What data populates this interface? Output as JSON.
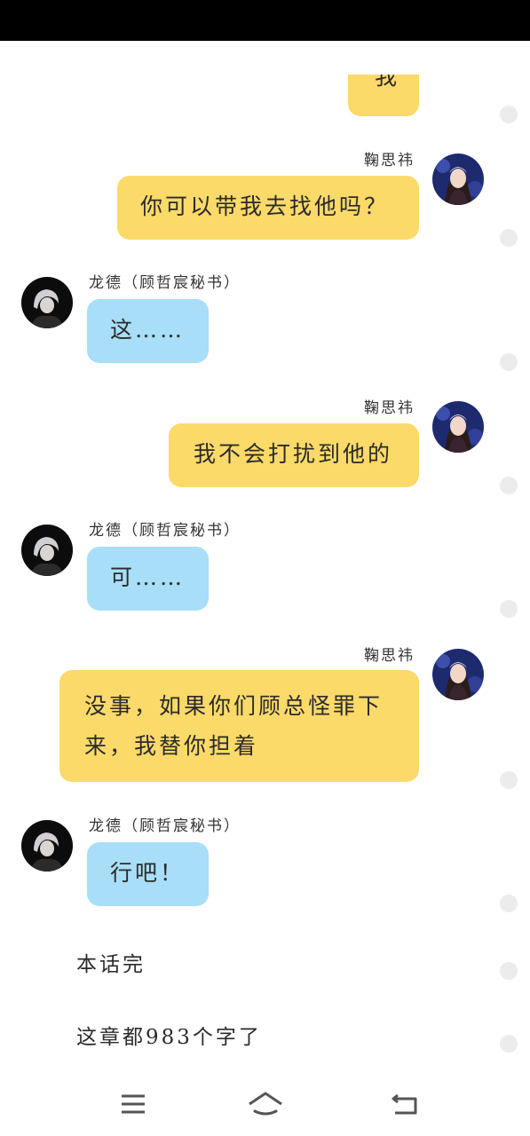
{
  "colors": {
    "my_bubble": "#fbda6a",
    "their_bubble": "#a8def8",
    "status_bar": "#000000"
  },
  "chat": {
    "partial_top": {
      "text": "我"
    },
    "messages": [
      {
        "sender": "鞠思祎",
        "side": "right",
        "text": "你可以带我去找他吗？"
      },
      {
        "sender": "龙德（顾哲宸秘书）",
        "side": "left",
        "text": "这……"
      },
      {
        "sender": "鞠思祎",
        "side": "right",
        "text": "我不会打扰到他的"
      },
      {
        "sender": "龙德（顾哲宸秘书）",
        "side": "left",
        "text": "可……"
      },
      {
        "sender": "鞠思祎",
        "side": "right",
        "lines": [
          "没事，如果你们顾总怪罪下",
          "来，我替你担着"
        ]
      },
      {
        "sender": "龙德（顾哲宸秘书）",
        "side": "left",
        "text": "行吧！"
      }
    ]
  },
  "footer_text": {
    "end_note": "本话完",
    "word_count_note": "这章都983个字了"
  },
  "nav": {
    "menu_icon": "menu-icon",
    "home_icon": "home-icon",
    "back_icon": "back-icon"
  }
}
